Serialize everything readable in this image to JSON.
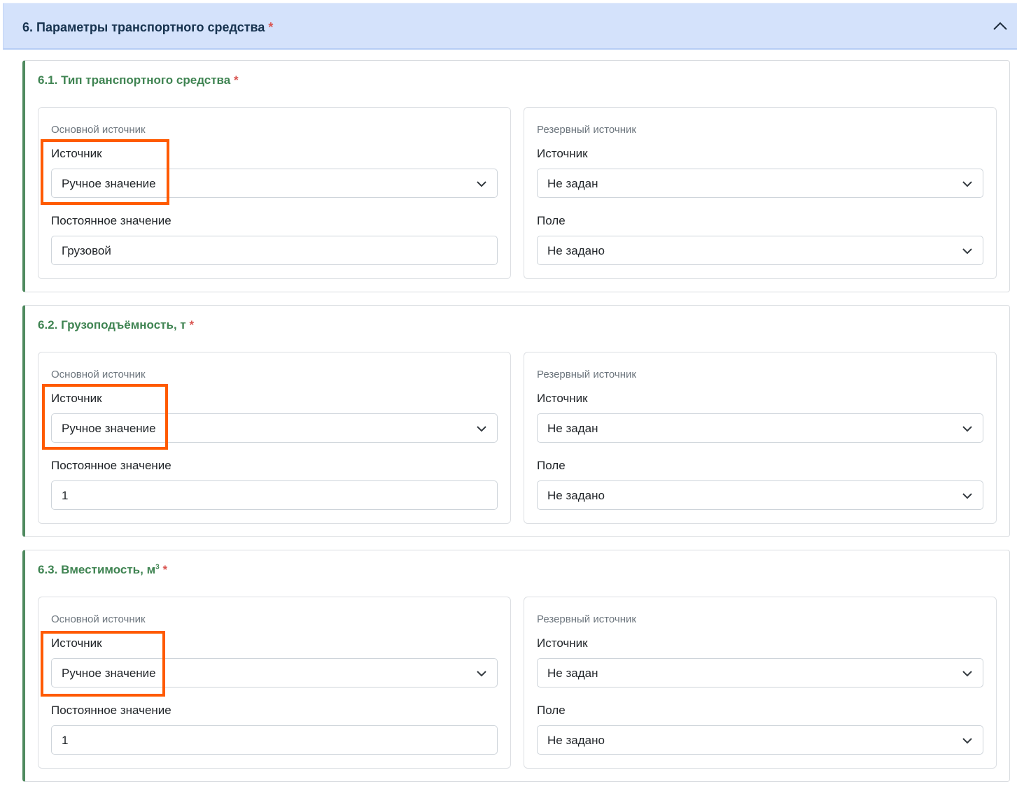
{
  "section": {
    "title": "6. Параметры транспортного средства",
    "required_mark": "*"
  },
  "cards": [
    {
      "title": "6.1. Тип транспортного средства",
      "title_sup": "",
      "required_mark": "*",
      "primary": {
        "heading": "Основной источник",
        "source_label": "Источник",
        "source_value": "Ручное значение",
        "const_label": "Постоянное значение",
        "const_value": "Грузовой"
      },
      "backup": {
        "heading": "Резервный источник",
        "source_label": "Источник",
        "source_value": "Не задан",
        "field_label": "Поле",
        "field_value": "Не задано"
      }
    },
    {
      "title": "6.2. Грузоподъёмность, т",
      "title_sup": "",
      "required_mark": "*",
      "primary": {
        "heading": "Основной источник",
        "source_label": "Источник",
        "source_value": "Ручное значение",
        "const_label": "Постоянное значение",
        "const_value": "1"
      },
      "backup": {
        "heading": "Резервный источник",
        "source_label": "Источник",
        "source_value": "Не задан",
        "field_label": "Поле",
        "field_value": "Не задано"
      }
    },
    {
      "title": "6.3. Вместимость, м",
      "title_sup": "3",
      "required_mark": "*",
      "primary": {
        "heading": "Основной источник",
        "source_label": "Источник",
        "source_value": "Ручное значение",
        "const_label": "Постоянное значение",
        "const_value": "1"
      },
      "backup": {
        "heading": "Резервный источник",
        "source_label": "Источник",
        "source_value": "Не задан",
        "field_label": "Поле",
        "field_value": "Не задано"
      }
    }
  ],
  "colors": {
    "header_bg": "#d4e2fb",
    "card_accent": "#4f8a5f",
    "card_title": "#3f8452",
    "required": "#d9534f",
    "highlight": "#ff5a00"
  },
  "icons": {
    "collapse": "chevron-up-icon",
    "select": "chevron-down-icon"
  }
}
